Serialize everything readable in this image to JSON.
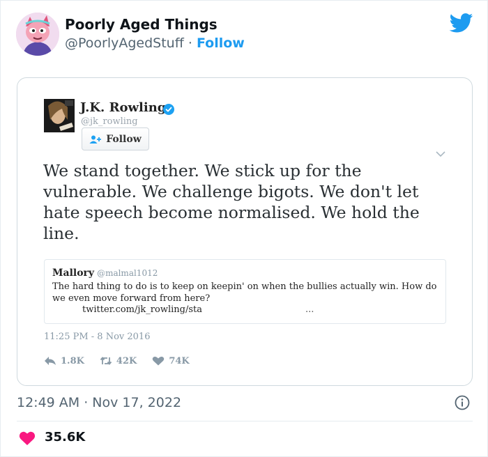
{
  "embed": {
    "author_name": "Poorly Aged Things",
    "author_handle": "@PoorlyAgedStuff",
    "separator": "·",
    "follow_label": "Follow",
    "icons": {
      "avatar": "cartoon-avatar",
      "brand": "twitter-bird-icon"
    }
  },
  "screenshot_tweet": {
    "name": "J.K. Rowling",
    "handle": "@jk_rowling",
    "follow_label": "Follow",
    "text": "We stand together. We stick up for the vulnerable. We challenge bigots. We don't let hate speech become normalised. We hold the line.",
    "quoted": {
      "name": "Mallory",
      "handle": "@malmal1012",
      "text": "The hard thing to do is to keep on keepin' on when the bullies actually win. How do we even move forward from here?",
      "link": "twitter.com/jk_rowling/sta",
      "ellipsis": "..."
    },
    "timestamp": "11:25 PM - 8 Nov 2016",
    "stats": {
      "replies": "1.8K",
      "retweets": "42K",
      "likes": "74K"
    }
  },
  "footer": {
    "post_time": "12:49 AM · Nov 17, 2022",
    "like_count": "35.6K"
  },
  "colors": {
    "accent": "#1d9bf0",
    "heart": "#f91880",
    "muted": "#536471"
  }
}
